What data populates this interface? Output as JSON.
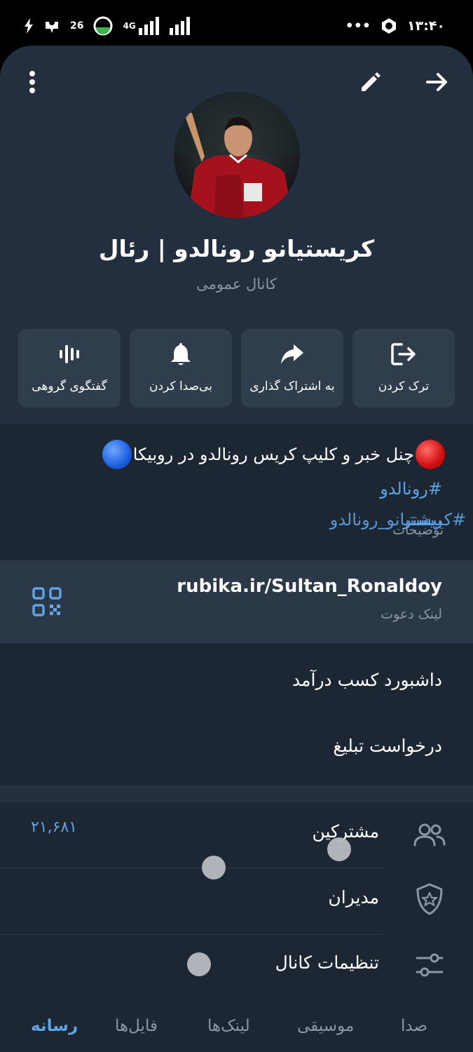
{
  "status_bar": {
    "time": "۱۳:۴۰",
    "dots": "•••",
    "data_speed": "26",
    "network": "4G"
  },
  "header": {
    "back_icon": "arrow-right-icon",
    "edit_icon": "pencil-icon",
    "menu_icon": "more-vertical-icon"
  },
  "channel": {
    "name": "کریستیانو رونالدو | رئال",
    "type": "کانال عمومی"
  },
  "actions": [
    {
      "label": "ترک کردن",
      "icon": "leave-icon"
    },
    {
      "label": "به اشتراک گذاری",
      "icon": "share-icon"
    },
    {
      "label": "بی‌صدا کردن",
      "icon": "bell-icon"
    },
    {
      "label": "گفتگوی گروهی",
      "icon": "voice-chat-icon"
    }
  ],
  "description": {
    "text": "چنل خبر و کلیپ کریس رونالدو در روبیکا",
    "hashtag": "#رونالدو",
    "more_overlap": "#کریستیانو_رونالدو",
    "more": "بیشتر",
    "caption": "توضیحات"
  },
  "invite": {
    "link": "rubika.ir/Sultan_Ronaldoy",
    "caption": "لینک دعوت"
  },
  "menu": {
    "earnings": "داشبورد کسب درآمد",
    "ad_request": "درخواست تبلیغ"
  },
  "info_rows": {
    "subscribers_label": "مشترکین",
    "subscribers_count": "۲۱,۶۸۱",
    "admins_label": "مدیران",
    "settings_label": "تنظیمات کانال"
  },
  "tabs": [
    "صدا",
    "موسیقی",
    "لینک‌ها",
    "فایل‌ها",
    "رسانه"
  ],
  "active_tab": "رسانه",
  "colors": {
    "background": "#232f3e",
    "panel": "#1d2734",
    "accent": "#5ea4e6",
    "muted": "#8d97a3"
  }
}
